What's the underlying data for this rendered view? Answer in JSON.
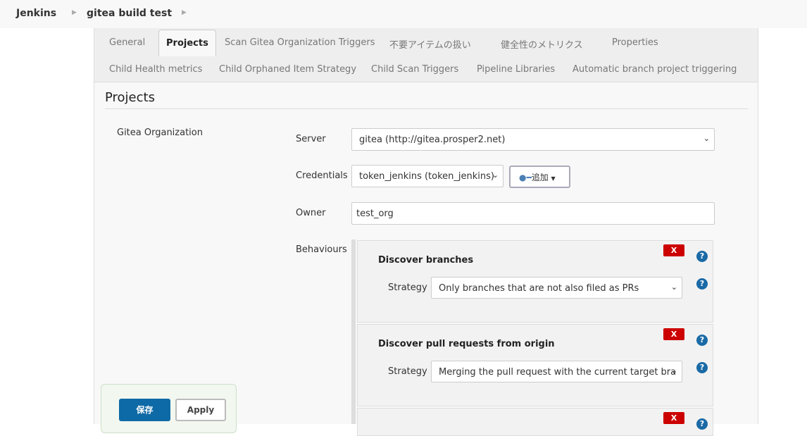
{
  "breadcrumb": {
    "root": "Jenkins",
    "job": "gitea build test"
  },
  "tabs": [
    "General",
    "Projects",
    "Scan Gitea Organization Triggers",
    "不要アイテムの扱い",
    "健全性のメトリクス",
    "Properties",
    "Child Health metrics",
    "Child Orphaned Item Strategy",
    "Child Scan Triggers",
    "Pipeline Libraries",
    "Automatic branch project triggering"
  ],
  "section": {
    "title": "Projects",
    "subtitle": "Gitea Organization"
  },
  "form": {
    "server_label": "Server",
    "server_value": "gitea (http://gitea.prosper2.net)",
    "credentials_label": "Credentials",
    "credentials_value": "token_jenkins (token_jenkins)",
    "add_label": "追加",
    "owner_label": "Owner",
    "owner_value": "test_org",
    "behaviours_label": "Behaviours"
  },
  "behaviours": [
    {
      "title": "Discover branches",
      "strategy_label": "Strategy",
      "strategy_value": "Only branches that are not also filed as PRs"
    },
    {
      "title": "Discover pull requests from origin",
      "strategy_label": "Strategy",
      "strategy_value": "Merging the pull request with the current target bra"
    }
  ],
  "icons": {
    "remove": "X",
    "help": "?"
  },
  "buttons": {
    "save": "保存",
    "apply": "Apply"
  }
}
